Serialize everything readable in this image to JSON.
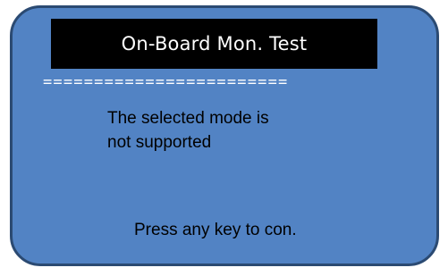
{
  "screen": {
    "title": "On-Board Mon. Test",
    "separator": "========================",
    "message": {
      "line1": "The selected mode is",
      "line2": "not supported"
    },
    "footer": "Press any key to con."
  },
  "colors": {
    "screen_background": "#5283c4",
    "screen_border": "#2b4a72",
    "title_background": "#000000",
    "title_text": "#ffffff",
    "body_text": "#000000"
  }
}
